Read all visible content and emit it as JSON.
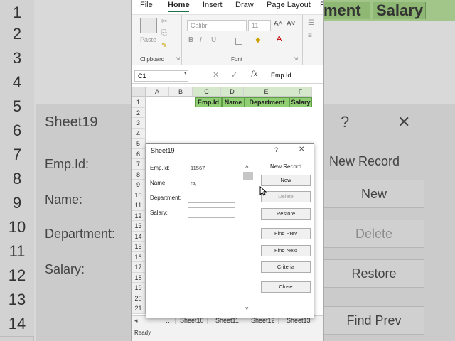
{
  "background": {
    "row_numbers": [
      "1",
      "2",
      "3",
      "4",
      "5",
      "6",
      "7",
      "8",
      "9",
      "10",
      "11",
      "12",
      "13",
      "14"
    ],
    "header_cells": [
      "ment",
      "Salary"
    ],
    "dialog_title": "Sheet19",
    "labels": [
      "Emp.Id:",
      "Name:",
      "Department:",
      "Salary:"
    ],
    "question_mark": "?",
    "close_glyph": "✕",
    "record_label": "New Record",
    "buttons": [
      "New",
      "Delete",
      "Restore",
      "Find Prev"
    ]
  },
  "excel": {
    "menu": [
      "File",
      "Home",
      "Insert",
      "Draw",
      "Page Layout",
      "F"
    ],
    "active_menu": "Home",
    "ribbon": {
      "paste": "Paste",
      "clipboard_label": "Clipboard",
      "font_name": "Calibri",
      "font_size": "11",
      "font_label": "Font",
      "bold": "B",
      "italic": "I",
      "underline": "U",
      "grow_font": "A˄",
      "shrink_font": "A˅",
      "font_color": "A"
    },
    "formula_bar": {
      "name_box": "C1",
      "fx": "fx",
      "formula": "Emp.Id"
    },
    "columns": [
      "A",
      "B",
      "C",
      "D",
      "E",
      "F"
    ],
    "rows": [
      "1",
      "2",
      "3",
      "4",
      "5",
      "6",
      "7",
      "8",
      "9",
      "10",
      "11",
      "12",
      "13",
      "14",
      "15",
      "16",
      "17",
      "18",
      "19",
      "20",
      "21"
    ],
    "header_row": [
      "Emp.Id",
      "Name",
      "Department",
      "Salary"
    ],
    "sheet_tabs": [
      "…",
      "Sheet10",
      "Sheet11",
      "Sheet12",
      "Sheet13"
    ],
    "status": "Ready",
    "header_fill": "#8fce72"
  },
  "dialog": {
    "title": "Sheet19",
    "help": "?",
    "close": "✕",
    "record_label": "New Record",
    "fields": [
      {
        "label": "Emp.Id:",
        "value": "11567"
      },
      {
        "label": "Name:",
        "value": "raj"
      },
      {
        "label": "Department:",
        "value": ""
      },
      {
        "label": "Salary:",
        "value": ""
      }
    ],
    "buttons": [
      "New",
      "Delete",
      "Restore",
      "Find Prev",
      "Find Next",
      "Criteria",
      "Close"
    ]
  }
}
